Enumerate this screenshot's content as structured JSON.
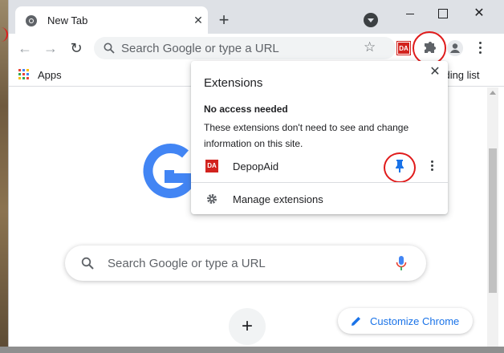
{
  "tab": {
    "title": "New Tab",
    "close_glyph": "✕",
    "favicon": "chrome-icon"
  },
  "tabstrip": {
    "new_tab_glyph": "+",
    "close_glyph": "✕"
  },
  "toolbar": {
    "back_glyph": "←",
    "forward_glyph": "→",
    "reload_glyph": "↻",
    "omnibox_placeholder": "Search Google or type a URL",
    "star_glyph": "☆",
    "extension_badge": "DA"
  },
  "bookmarks": {
    "apps_label": "Apps",
    "reading_list_label": "eading list"
  },
  "content": {
    "search_placeholder": "Search Google or type a URL",
    "add_shortcut_glyph": "+",
    "customize_label": "Customize Chrome"
  },
  "extensions_popup": {
    "title": "Extensions",
    "close_glyph": "✕",
    "section_heading": "No access needed",
    "section_description": "These extensions don't need to see and change information on this site.",
    "items": [
      {
        "name": "DepopAid",
        "badge": "DA",
        "pinned": true
      }
    ],
    "manage_label": "Manage extensions"
  },
  "colors": {
    "accent_blue": "#1a73e8",
    "google_blue": "#4285f4",
    "annotation_red": "#e01b1b",
    "extension_red": "#d2231e"
  }
}
